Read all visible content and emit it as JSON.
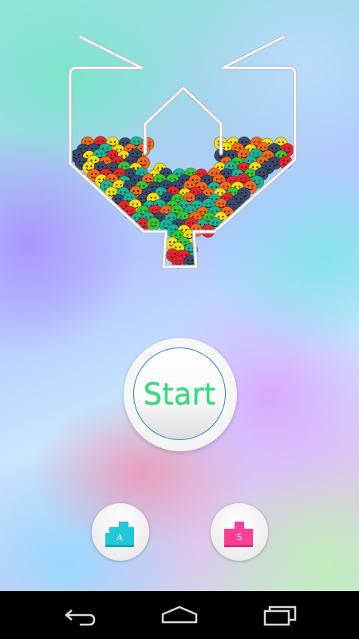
{
  "start_button": {
    "label": "Start"
  },
  "mode_buttons": [
    {
      "letter": "A",
      "color": "#21c8dc",
      "shadow": "#14a4b6"
    },
    {
      "letter": "S",
      "color": "#ff3f93",
      "shadow": "#d8287a"
    }
  ],
  "ball_colors": {
    "navy": "#394a6e",
    "yellow": "#f6dc12",
    "orange": "#f26a1b",
    "green": "#35c935",
    "teal": "#1ab79a",
    "red": "#e82530"
  },
  "nav_icons": [
    "back-icon",
    "home-icon",
    "recent-apps-icon"
  ]
}
